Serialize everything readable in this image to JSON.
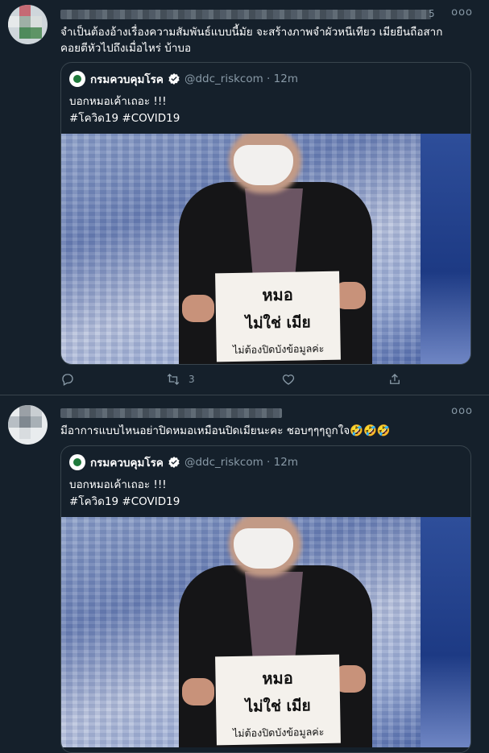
{
  "tweets": [
    {
      "author_blurred": true,
      "time": "5",
      "text_line1": "จำเป็นต้องอ้างเรื่องความสัมพันธ์แบบนี้มัย จะสร้างภาพจำผัวหนีเทียว เมียยืนถือสาก",
      "text_line2": "คอยตีหัวไปถึงเมื่อไหร่ บ้าบอ",
      "quote": {
        "name": "กรมควบคุมโรค",
        "handle": "@ddc_riskcom · 12m",
        "text_line1": "บอกหมอเค้าเถอะ !!!",
        "text_line2": "#โควิด19 #COVID19",
        "sign_line1": "หมอ",
        "sign_line2": "ไม่ใช่ เมีย",
        "sign_line3": "ไม่ต้องปิดบังข้อมูลค่ะ"
      },
      "actions": {
        "reply": "",
        "retweet": "3",
        "like": "",
        "share": ""
      }
    },
    {
      "author_blurred": true,
      "text": "มีอาการแบบไหนอย่าปิดหมอเหมือนปิดเมียนะคะ  ชอบๆๆๆถูกใจ🤣🤣🤣",
      "quote": {
        "name": "กรมควบคุมโรค",
        "handle": "@ddc_riskcom · 12m",
        "text_line1": "บอกหมอเค้าเถอะ !!!",
        "text_line2": "#โควิด19 #COVID19",
        "sign_line1": "หมอ",
        "sign_line2": "ไม่ใช่ เมีย",
        "sign_line3": "ไม่ต้องปิดบังข้อมูลค่ะ"
      }
    }
  ],
  "more_label": "ooo",
  "colors": {
    "background": "#15202b",
    "border": "#38444d",
    "muted": "#8899a6",
    "verified": "#ffffff"
  }
}
